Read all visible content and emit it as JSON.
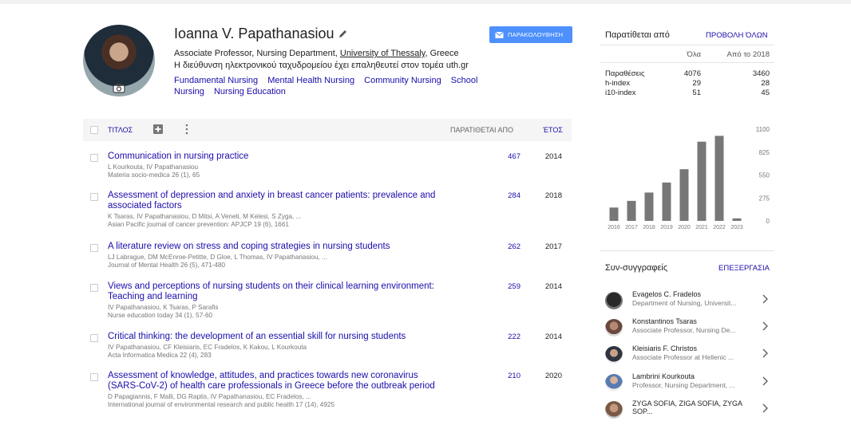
{
  "profile": {
    "name": "Ioanna V. Papathanasiou",
    "affiliation_prefix": "Associate Professor, Nursing Department, ",
    "affiliation_link": "University of Thessaly",
    "affiliation_suffix": ", Greece",
    "email_note": "Η διεύθυνση ηλεκτρονικού ταχυδρομείου έχει επαληθευτεί στον τομέα uth.gr",
    "interests": [
      "Fundamental Nursing",
      "Mental Health Nursing",
      "Community Nursing",
      "School Nursing",
      "Nursing Education"
    ],
    "follow_label": "ΠΑΡΑΚΟΛΟΥΘΗΣΗ",
    "icons": {
      "edit": "pencil-icon",
      "camera": "camera-icon",
      "follow": "mail-icon"
    }
  },
  "table": {
    "title_col": "ΤΙΤΛΟΣ",
    "cited_col": "ΠΑΡΑΤΙΘΕΤΑΙ ΑΠΟ",
    "year_col": "ΈΤΟΣ",
    "articles": [
      {
        "title": "Communication in nursing practice",
        "authors": "L Kourkouta, IV Papathanasiou",
        "venue": "Materia socio-medica 26 (1), 65",
        "cited": "467",
        "year": "2014"
      },
      {
        "title": "Assessment of depression and anxiety in breast cancer patients: prevalence and associated factors",
        "authors": "K Tsaras, IV Papathanasiou, D Mitsi, A Veneti, M Kelesi, S Zyga, ...",
        "venue": "Asian Pacific journal of cancer prevention: APJCP 19 (6), 1661",
        "cited": "284",
        "year": "2018"
      },
      {
        "title": "A literature review on stress and coping strategies in nursing students",
        "authors": "LJ Labrague, DM McEnroe-Petitte, D Gloe, L Thomas, IV Papathanasiou, ...",
        "venue": "Journal of Mental Health 26 (5), 471-480",
        "cited": "262",
        "year": "2017"
      },
      {
        "title": "Views and perceptions of nursing students on their clinical learning environment: Teaching and learning",
        "authors": "IV Papathanasiou, K Tsaras, P Sarafis",
        "venue": "Nurse education today 34 (1), 57-60",
        "cited": "259",
        "year": "2014"
      },
      {
        "title": "Critical thinking: the development of an essential skill for nursing students",
        "authors": "IV Papathanasiou, CF Kleisiaris, EC Fradelos, K Kakou, L Kourkouta",
        "venue": "Acta Informatica Medica 22 (4), 283",
        "cited": "222",
        "year": "2014"
      },
      {
        "title": "Assessment of knowledge, attitudes, and practices towards new coronavirus (SARS-CoV-2) of health care professionals in Greece before the outbreak period",
        "authors": "D Papagiannis, F Malli, DG Raptis, IV Papathanasiou, EC Fradelos, ...",
        "venue": "International journal of environmental research and public health 17 (14), 4925",
        "cited": "210",
        "year": "2020"
      }
    ]
  },
  "sidebar": {
    "cited_by": "Παρατίθεται από",
    "view_all": "ΠΡΟΒΟΛΗ ΌΛΩΝ",
    "col_all": "Όλα",
    "col_since": "Από το 2018",
    "metrics": [
      {
        "label": "Παραθέσεις",
        "all": "4076",
        "since": "3460"
      },
      {
        "label": "h-index",
        "all": "29",
        "since": "28"
      },
      {
        "label": "i10-index",
        "all": "51",
        "since": "45"
      }
    ],
    "coauthors_title": "Συν-συγγραφείς",
    "edit_label": "ΕΠΕΞΕΡΓΑΣΙΑ",
    "coauthors": [
      {
        "name": "Evagelos C. Fradelos",
        "affiliation": "Department of Nursing, Universit..."
      },
      {
        "name": "Konstantinos Tsaras",
        "affiliation": "Associate Professor, Nursing De..."
      },
      {
        "name": "Kleisiaris F. Christos",
        "affiliation": "Associate Professor at Hellenic ..."
      },
      {
        "name": "Lambrini Kourkouta",
        "affiliation": "Professor, Nursing Department, ..."
      },
      {
        "name": "ZYGA SOFIA, ZIGA SOFIA, ZYGA SOP...",
        "affiliation": ""
      }
    ]
  },
  "chart_data": {
    "type": "bar",
    "categories": [
      "2016",
      "2017",
      "2018",
      "2019",
      "2020",
      "2021",
      "2022",
      "2023"
    ],
    "values": [
      160,
      240,
      340,
      460,
      620,
      950,
      1020,
      30
    ],
    "ylim": [
      0,
      1100
    ],
    "yticks": [
      "1100",
      "825",
      "550",
      "275",
      "0"
    ],
    "bar_color": "#777777"
  },
  "colors": {
    "link": "#1a0dab",
    "button": "#4d90fe"
  }
}
